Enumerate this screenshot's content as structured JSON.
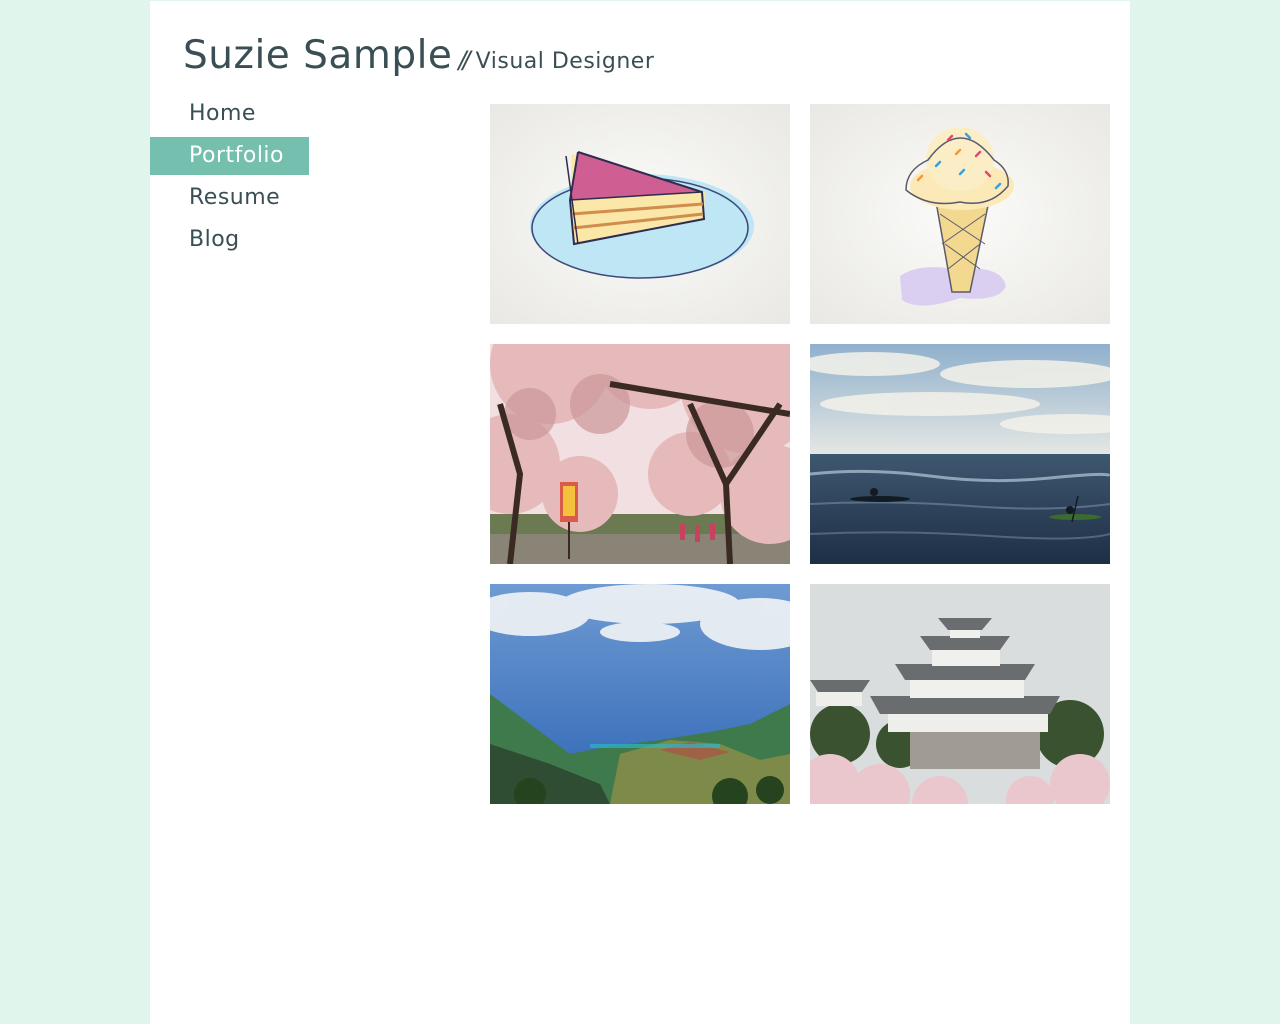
{
  "header": {
    "name": "Suzie Sample",
    "separator": "//",
    "tagline": "Visual Designer"
  },
  "nav": {
    "items": [
      {
        "label": "Home",
        "active": false
      },
      {
        "label": "Portfolio",
        "active": true
      },
      {
        "label": "Resume",
        "active": false
      },
      {
        "label": "Blog",
        "active": false
      }
    ]
  },
  "colors": {
    "background": "#e0f5ec",
    "accent": "#74bfad",
    "text": "#3a4f53"
  },
  "portfolio": {
    "thumbnails": [
      {
        "subject": "cake-illustration"
      },
      {
        "subject": "ice-cream-illustration"
      },
      {
        "subject": "cherry-blossom-photo"
      },
      {
        "subject": "ocean-kayak-photo"
      },
      {
        "subject": "coastal-valley-photo"
      },
      {
        "subject": "castle-photo"
      }
    ]
  }
}
